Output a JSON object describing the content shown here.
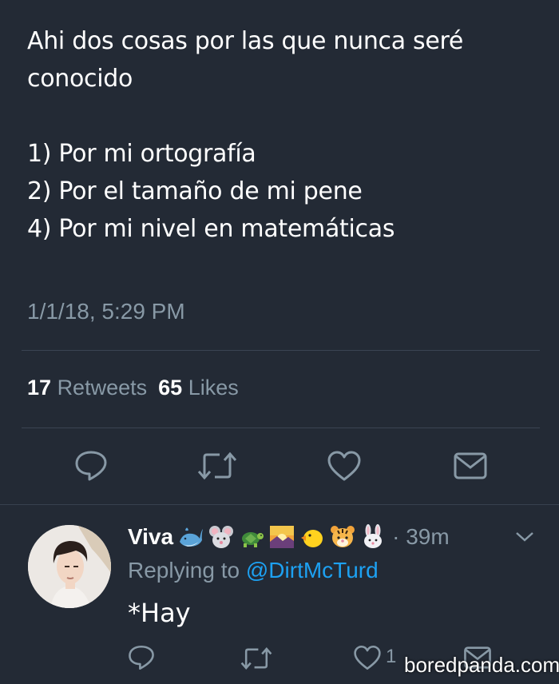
{
  "tweet": {
    "lines": [
      "Ahi dos cosas por las que nunca seré",
      "conocido",
      "1) Por mi ortografía",
      "2) Por el tamaño de mi pene",
      "4) Por mi nivel en matemáticas"
    ],
    "timestamp": "1/1/18, 5:29 PM",
    "retweets_count": "17",
    "retweets_label": "Retweets",
    "likes_count": "65",
    "likes_label": "Likes"
  },
  "reply": {
    "name": "Viva",
    "emoji_icons": [
      "whale-emoji",
      "mouse-emoji",
      "turtle-emoji",
      "sunrise-emoji",
      "chick-emoji",
      "tiger-emoji",
      "rabbit-emoji"
    ],
    "time": "· 39m",
    "replying_prefix": "Replying to",
    "replying_handle": "@DirtMcTurd",
    "text": "*Hay",
    "like_count": "1"
  },
  "watermark": "boredpanda.com",
  "colors": {
    "background": "#232a35",
    "text": "#ffffff",
    "muted": "#8899a6",
    "link": "#1da1f2",
    "divider": "#3a4452"
  }
}
